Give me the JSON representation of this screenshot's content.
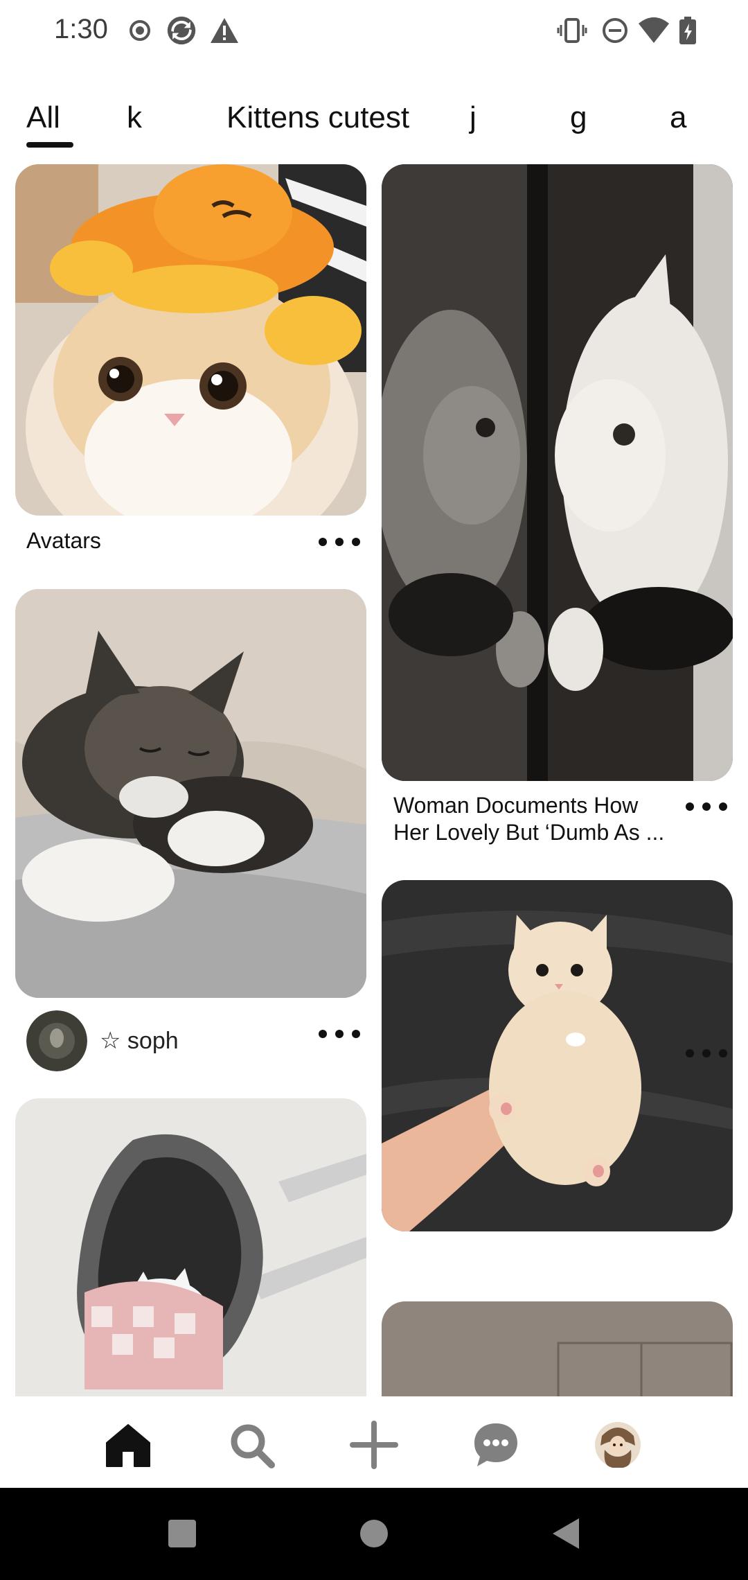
{
  "status_bar": {
    "time": "1:30",
    "left_icons": [
      "record-icon",
      "sync-app-icon",
      "warning-icon"
    ],
    "right_icons": [
      "vibrate-icon",
      "do-not-disturb-icon",
      "wifi-icon",
      "battery-charging-icon"
    ]
  },
  "tabs": [
    {
      "label": "All",
      "selected": true
    },
    {
      "label": "k",
      "selected": false
    },
    {
      "label": "Kittens cutest",
      "selected": false
    },
    {
      "label": "j",
      "selected": false
    },
    {
      "label": "g",
      "selected": false
    },
    {
      "label": "a",
      "selected": false
    }
  ],
  "feed": {
    "left_column": [
      {
        "title": "Avatars",
        "image": "cat-with-orange-octopus-plush"
      },
      {
        "creator": "☆ soph",
        "image": "sleeping-kittens-on-blanket"
      },
      {
        "image": "white-kitten-behind-wavy-mirror"
      }
    ],
    "right_column": [
      {
        "title_line1": "Woman Documents How",
        "title_line2": "Her Lovely But ‘Dumb As ...",
        "image": "cat-reflection-in-mirror"
      },
      {
        "image": "kitten-held-in-hand"
      },
      {
        "image": "room-wall"
      }
    ]
  },
  "bottom_nav": [
    {
      "name": "home",
      "icon": "home-icon",
      "active": true
    },
    {
      "name": "search",
      "icon": "search-icon",
      "active": false
    },
    {
      "name": "create",
      "icon": "plus-icon",
      "active": false
    },
    {
      "name": "messages",
      "icon": "chat-bubble-icon",
      "active": false
    },
    {
      "name": "profile",
      "icon": "avatar-icon",
      "active": false
    }
  ],
  "system_nav": [
    "recents-button",
    "home-button",
    "back-button"
  ],
  "colors": {
    "text": "#111111",
    "background": "#ffffff",
    "nav_icon_inactive": "#808080",
    "system_bar": "#000000"
  }
}
